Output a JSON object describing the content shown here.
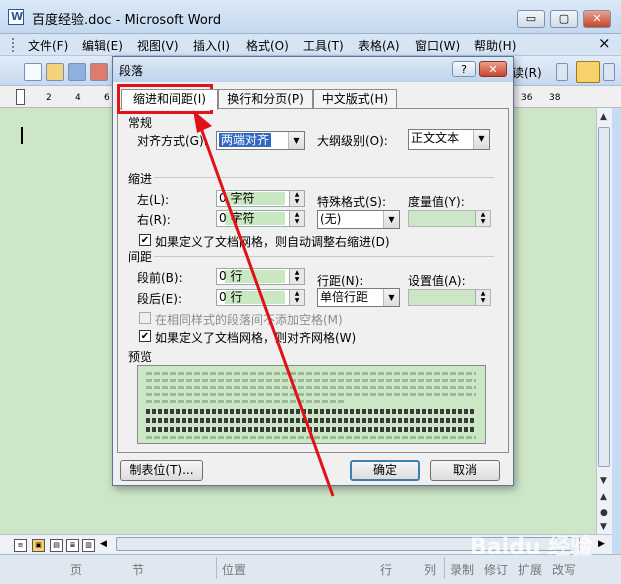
{
  "window": {
    "title": "百度经验.doc - Microsoft Word",
    "minimize": "▭",
    "restore": "▢",
    "close": "✕"
  },
  "menubar": {
    "items": [
      {
        "label": "文件(F)",
        "name": "menu-file"
      },
      {
        "label": "编辑(E)",
        "name": "menu-edit"
      },
      {
        "label": "视图(V)",
        "name": "menu-view"
      },
      {
        "label": "插入(I)",
        "name": "menu-insert"
      },
      {
        "label": "格式(O)",
        "name": "menu-format"
      },
      {
        "label": "工具(T)",
        "name": "menu-tools"
      },
      {
        "label": "表格(A)",
        "name": "menu-table"
      },
      {
        "label": "窗口(W)",
        "name": "menu-window"
      },
      {
        "label": "帮助(H)",
        "name": "menu-help"
      }
    ],
    "close_doc": "×"
  },
  "toolbar": {
    "read_label": "读(R)"
  },
  "ruler": {
    "left_ticks": [
      "2",
      "4",
      "6"
    ],
    "right_ticks": [
      "36",
      "38"
    ]
  },
  "statusbar": {
    "page": "页",
    "section": "节",
    "position": "位置",
    "line": "行",
    "column": "列",
    "record": "录制",
    "revise": "修订",
    "extend": "扩展",
    "overwrite": "改写"
  },
  "watermark": "Baidu 经验",
  "dialog": {
    "title": "段落",
    "help": "?",
    "close": "✕",
    "tabs": [
      {
        "label": "缩进和间距(I)",
        "active": true
      },
      {
        "label": "换行和分页(P)",
        "active": false
      },
      {
        "label": "中文版式(H)",
        "active": false
      }
    ],
    "general": {
      "heading": "常规",
      "align_label": "对齐方式(G):",
      "align_value": "两端对齐",
      "outline_label": "大纲级别(O):",
      "outline_value": "正文文本"
    },
    "indent": {
      "heading": "缩进",
      "left_label": "左(L):",
      "left_value": "0 字符",
      "right_label": "右(R):",
      "right_value": "0 字符",
      "special_label": "特殊格式(S):",
      "special_value": "(无)",
      "measure_label": "度量值(Y):",
      "grid_check": "如果定义了文档网格，则自动调整右缩进(D)"
    },
    "spacing": {
      "heading": "间距",
      "before_label": "段前(B):",
      "before_value": "0 行",
      "after_label": "段后(E):",
      "after_value": "0 行",
      "line_label": "行距(N):",
      "line_value": "单倍行距",
      "at_label": "设置值(A):",
      "no_space_check": "在相同样式的段落间不添加空格(M)",
      "snap_check": "如果定义了文档网格，则对齐网格(W)"
    },
    "preview_heading": "预览",
    "tabs_button": "制表位(T)...",
    "ok_button": "确定",
    "cancel_button": "取消"
  }
}
